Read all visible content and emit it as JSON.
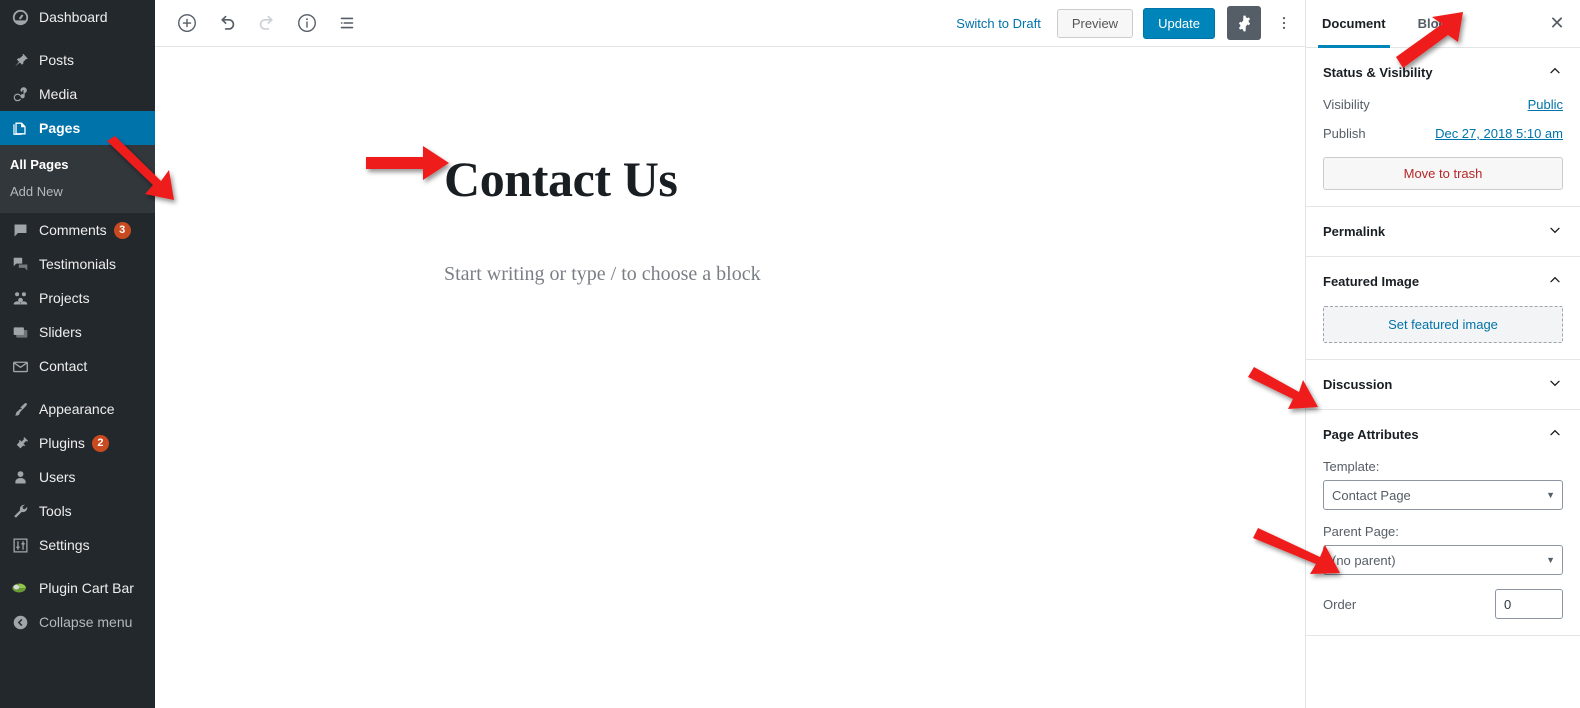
{
  "sidebar": {
    "items": [
      {
        "label": "Dashboard",
        "icon": "dashboard-icon",
        "name": "dashboard"
      },
      {
        "label": "Posts",
        "icon": "pin-icon",
        "name": "posts"
      },
      {
        "label": "Media",
        "icon": "media-icon",
        "name": "media"
      },
      {
        "label": "Pages",
        "icon": "pages-icon",
        "name": "pages",
        "current": true
      },
      {
        "label": "Comments",
        "icon": "comments-icon",
        "name": "comments",
        "badge": "3"
      },
      {
        "label": "Testimonials",
        "icon": "testimonials-icon",
        "name": "testimonials"
      },
      {
        "label": "Projects",
        "icon": "projects-icon",
        "name": "projects"
      },
      {
        "label": "Sliders",
        "icon": "sliders-icon",
        "name": "sliders"
      },
      {
        "label": "Contact",
        "icon": "envelope-icon",
        "name": "contact"
      },
      {
        "label": "Appearance",
        "icon": "brush-icon",
        "name": "appearance"
      },
      {
        "label": "Plugins",
        "icon": "plug-icon",
        "name": "plugins",
        "badge": "2"
      },
      {
        "label": "Users",
        "icon": "user-icon",
        "name": "users"
      },
      {
        "label": "Tools",
        "icon": "wrench-icon",
        "name": "tools"
      },
      {
        "label": "Settings",
        "icon": "sliders-settings-icon",
        "name": "settings"
      },
      {
        "label": "Plugin Cart Bar",
        "icon": "cart-bar-icon",
        "name": "plugin-cart-bar"
      },
      {
        "label": "Collapse menu",
        "icon": "collapse-icon",
        "name": "collapse-menu"
      }
    ],
    "submenu": [
      {
        "label": "All Pages",
        "current": true
      },
      {
        "label": "Add New",
        "current": false
      }
    ]
  },
  "toolbar": {
    "add_block": "add-block-icon",
    "undo": "undo-icon",
    "redo": "redo-icon",
    "info": "info-icon",
    "block_nav": "block-navigation-icon",
    "switch_to_draft": "Switch to Draft",
    "preview": "Preview",
    "update": "Update",
    "settings_gear": "gear-icon",
    "more_menu": "kebab-menu-icon"
  },
  "editor": {
    "title": "Contact Us",
    "body_placeholder": "Start writing or type / to choose a block"
  },
  "inspector": {
    "tabs": [
      {
        "label": "Document",
        "active": true
      },
      {
        "label": "Block",
        "active": false
      }
    ],
    "close": "✕",
    "status_visibility": {
      "title": "Status & Visibility",
      "visibility_label": "Visibility",
      "visibility_value": "Public",
      "publish_label": "Publish",
      "publish_value": "Dec 27, 2018 5:10 am",
      "trash_label": "Move to trash"
    },
    "permalink": {
      "title": "Permalink"
    },
    "featured_image": {
      "title": "Featured Image",
      "button_label": "Set featured image"
    },
    "discussion": {
      "title": "Discussion"
    },
    "page_attributes": {
      "title": "Page Attributes",
      "template_label": "Template:",
      "template_value": "Contact Page",
      "parent_label": "Parent Page:",
      "parent_value": "(no parent)",
      "order_label": "Order",
      "order_value": "0"
    }
  },
  "annotations": {
    "highlight_color": "#e8000d",
    "arrow_color": "#ef1c1c",
    "arrows": [
      {
        "name": "arrow-to-add-new",
        "target": "Add New"
      },
      {
        "name": "arrow-to-page-title",
        "target": "Contact Us"
      },
      {
        "name": "arrow-to-update-button",
        "target": "Update"
      },
      {
        "name": "arrow-to-set-featured-image",
        "target": "Set featured image"
      },
      {
        "name": "arrow-to-template-select",
        "target": "Contact Page"
      }
    ],
    "highlights": [
      {
        "name": "highlight-pages-menu-item",
        "target": "Pages"
      }
    ]
  },
  "colors": {
    "admin_bg": "#23282d",
    "submenu_bg": "#32373c",
    "accent_blue": "#0073aa",
    "button_blue": "#0085ba",
    "badge": "#ca4a1f"
  }
}
